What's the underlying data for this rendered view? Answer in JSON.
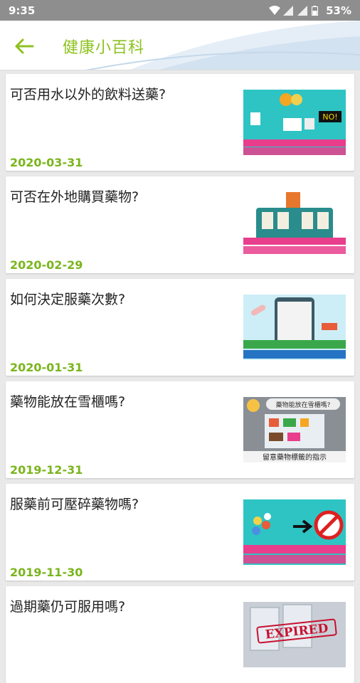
{
  "status": {
    "time": "9:35",
    "battery": "53%"
  },
  "header": {
    "title": "健康小百科"
  },
  "items": [
    {
      "question": "可否用水以外的飲料送藥?",
      "date": "2020-03-31",
      "thumb": "drinks-no"
    },
    {
      "question": "可否在外地購買藥物?",
      "date": "2020-02-29",
      "thumb": "suitcase"
    },
    {
      "question": "如何決定服藥次數?",
      "date": "2020-01-31",
      "thumb": "phone-pills"
    },
    {
      "question": "藥物能放在雪櫃嗎?",
      "date": "2019-12-31",
      "thumb": "fridge"
    },
    {
      "question": "服藥前可壓碎藥物嗎?",
      "date": "2019-11-30",
      "thumb": "crush-no"
    },
    {
      "question": "過期藥仍可服用嗎?",
      "date": "",
      "thumb": "expired"
    }
  ],
  "thumb_text": {
    "fridge_label": "藥物能放在雪櫃嗎?",
    "fridge_caption": "留意藥物標籤的指示",
    "expired_stamp": "EXPIRED",
    "no_badge": "NO!"
  },
  "colors": {
    "accent": "#8dc21f",
    "date": "#7ab51d",
    "statusbar": "#8e8e8e"
  }
}
